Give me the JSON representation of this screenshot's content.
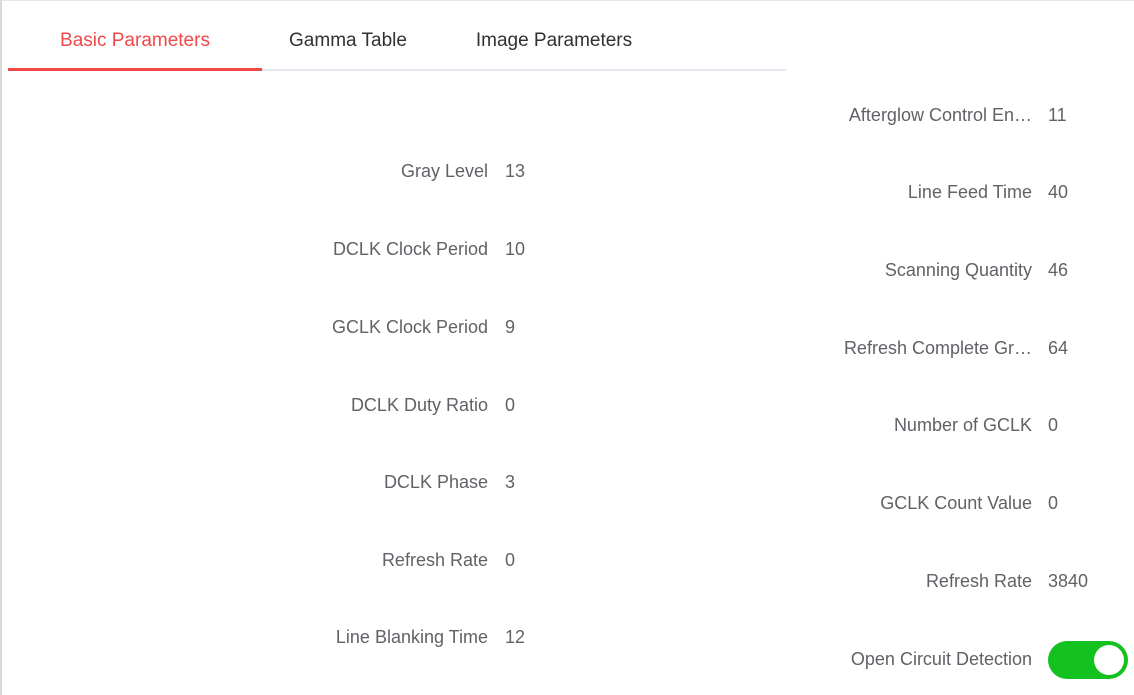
{
  "tabs": [
    {
      "label": "Basic Parameters",
      "active": true
    },
    {
      "label": "Gamma Table",
      "active": false
    },
    {
      "label": "Image Parameters",
      "active": false
    }
  ],
  "left_params": [
    {
      "label": "Gray Level",
      "value": "13"
    },
    {
      "label": "DCLK Clock Period",
      "value": "10"
    },
    {
      "label": "GCLK Clock Period",
      "value": "9"
    },
    {
      "label": "DCLK Duty Ratio",
      "value": "0"
    },
    {
      "label": "DCLK Phase",
      "value": "3"
    },
    {
      "label": "Refresh Rate",
      "value": "0"
    },
    {
      "label": "Line Blanking Time",
      "value": "12"
    }
  ],
  "right_params": [
    {
      "label": "Afterglow Control En…",
      "value": "11"
    },
    {
      "label": "Line Feed Time",
      "value": "40"
    },
    {
      "label": "Scanning Quantity",
      "value": "46"
    },
    {
      "label": "Refresh Complete Gr…",
      "value": "64"
    },
    {
      "label": "Number of GCLK",
      "value": "0"
    },
    {
      "label": "GCLK Count Value",
      "value": "0"
    },
    {
      "label": "Refresh Rate",
      "value": "3840"
    }
  ],
  "open_circuit": {
    "label": "Open Circuit Detection",
    "enabled": true
  },
  "colors": {
    "accent": "#f04848",
    "switch_on": "#13c21e"
  }
}
